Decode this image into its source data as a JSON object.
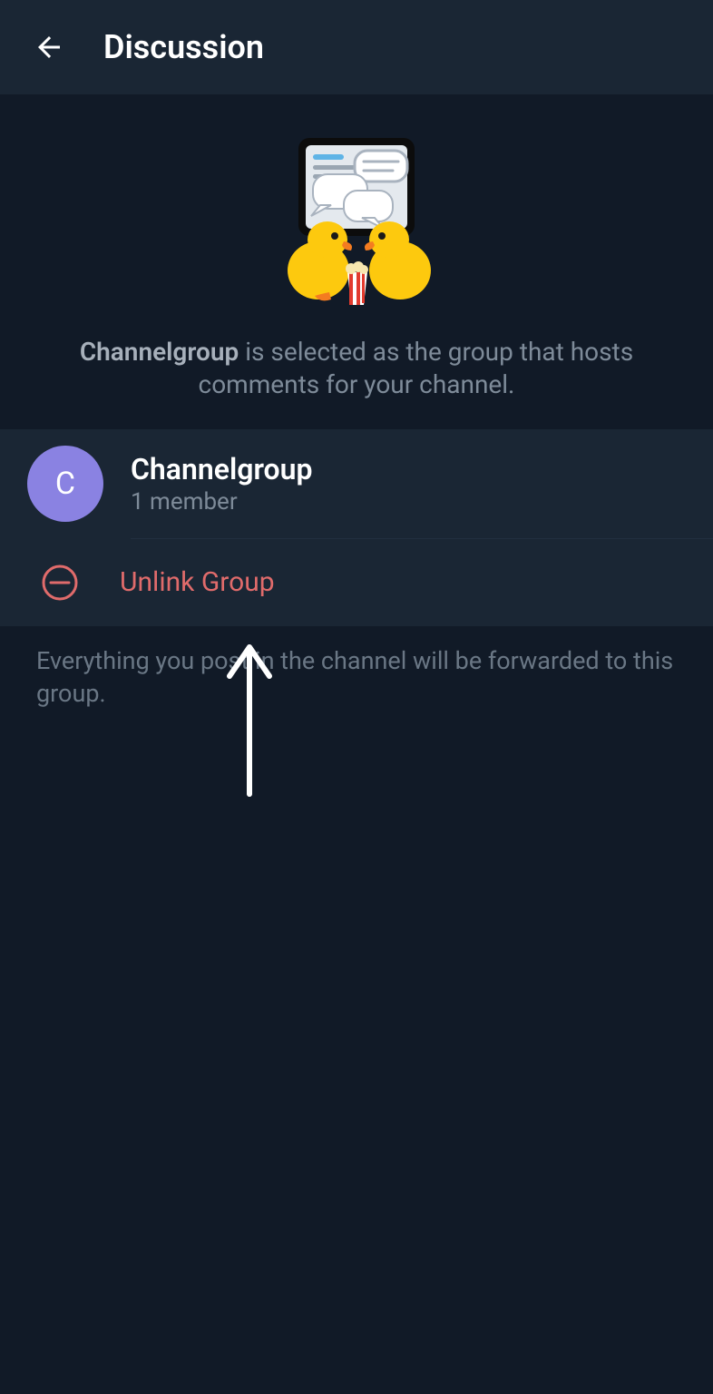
{
  "header": {
    "title": "Discussion"
  },
  "intro": {
    "group_name": "Channelgroup",
    "suffix": " is selected as the group that hosts comments for your channel."
  },
  "group": {
    "avatar_letter": "C",
    "name": "Channelgroup",
    "members": "1 member"
  },
  "unlink": {
    "label": "Unlink Group"
  },
  "footer": {
    "note": "Everything you post in the channel will be forwarded to this group."
  }
}
